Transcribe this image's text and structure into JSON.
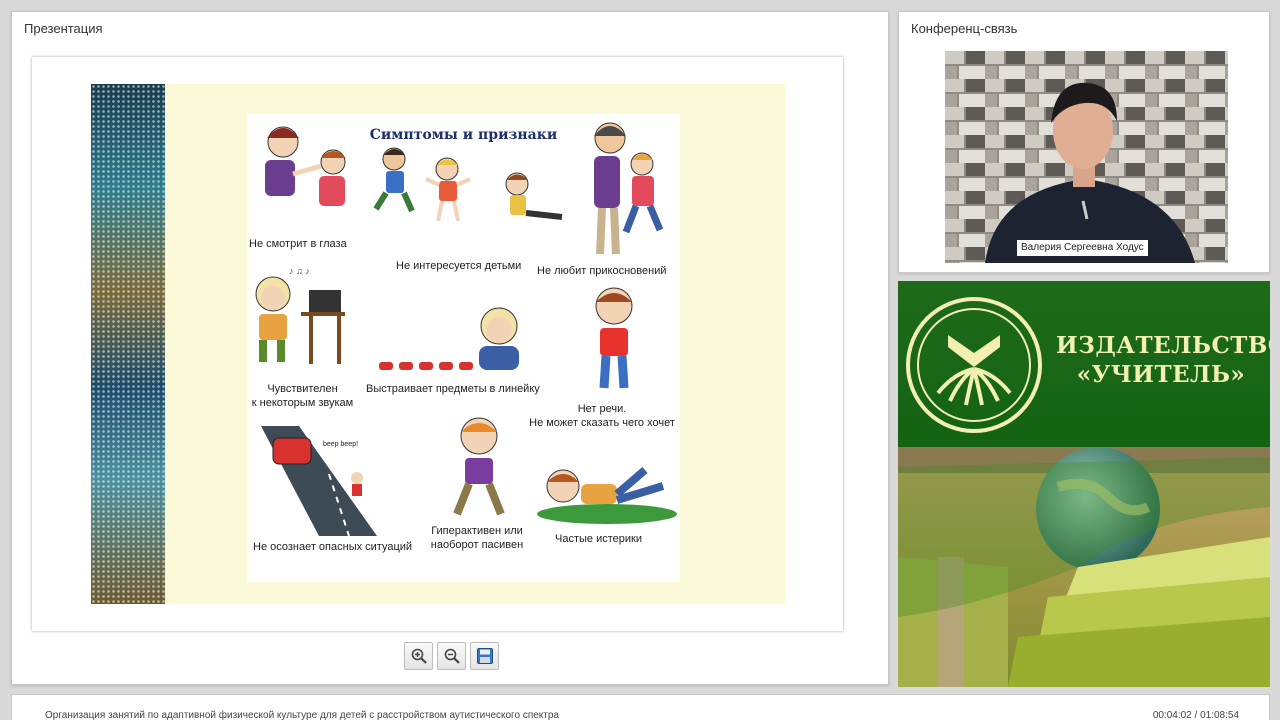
{
  "presentation": {
    "title": "Презентация",
    "slide": {
      "heading": "Симптомы и признаки",
      "captions": {
        "eye_contact": "Не смотрит в глаза",
        "children": "Не интересуется детьми",
        "touch": "Не любит прикосновений",
        "sounds_line1": "Чувствителен",
        "sounds_line2": "к некоторым звукам",
        "lines_up": "Выстраивает предметы в линейку",
        "speech_line1": "Нет речи.",
        "speech_line2": "Не может сказать чего хочет",
        "danger": "Не осознает опасных ситуаций",
        "hyper_line1": "Гиперактивен или",
        "hyper_line2": "наоборот пасивен",
        "tantrums": "Частые истерики"
      }
    },
    "toolbar": {
      "zoom_in_icon": "zoom-in-icon",
      "zoom_out_icon": "zoom-out-icon",
      "save_icon": "floppy-disk-icon"
    }
  },
  "conference": {
    "title": "Конференц-связь",
    "participant_name": "Валерия Сергеевна Ходус"
  },
  "ad": {
    "line1": "ИЗДАТЕЛЬСТВО",
    "line2": "«УЧИТЕЛЬ»",
    "colors": {
      "green": "#136313",
      "text": "#f2efb0"
    }
  },
  "footer": {
    "course_title": "Организация занятий по адаптивной физической культуре для детей с расстройством аутистического спектра",
    "time": "00:04:02 / 01:08:54"
  }
}
